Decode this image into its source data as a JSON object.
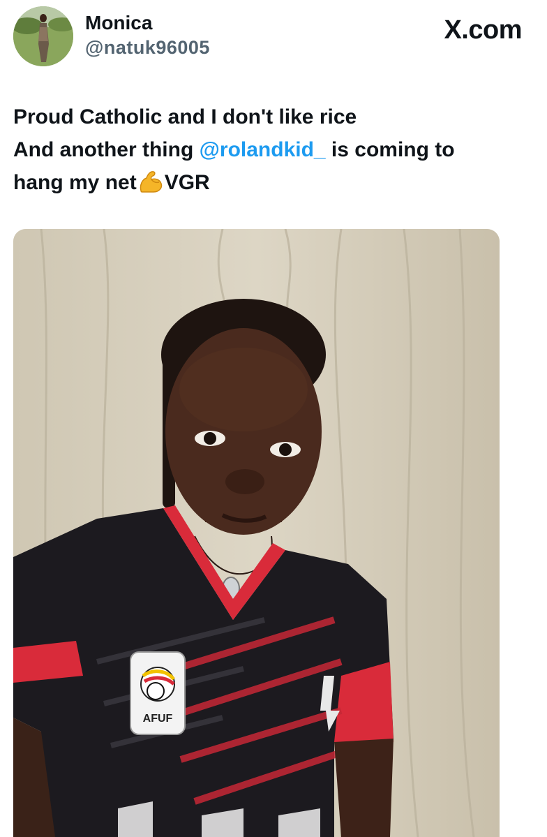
{
  "author": {
    "display_name": "Monica",
    "handle": "@natuk96005",
    "avatar_icon": "profile-photo-avatar"
  },
  "brand": {
    "logo_text": "X.com",
    "logo_icon": "x-logo-icon"
  },
  "tweet": {
    "line1": "Proud Catholic and I don't like rice",
    "line2_before": "And another thing ",
    "mention": "@rolandkid_",
    "line2_after": " is coming to",
    "line3_before": "hang my net",
    "emoji": "flexed-biceps-icon",
    "line3_after": "VGR"
  },
  "media": {
    "type": "photo",
    "jersey_badge_text": "AFUF",
    "colors": {
      "curtain": "#d6cfbd",
      "jersey_black": "#1c1a1f",
      "jersey_red": "#d92b3a",
      "skin": "#4a2a1e"
    }
  },
  "colors": {
    "text": "#0f1419",
    "muted": "#536471",
    "link": "#1d9bf0"
  }
}
